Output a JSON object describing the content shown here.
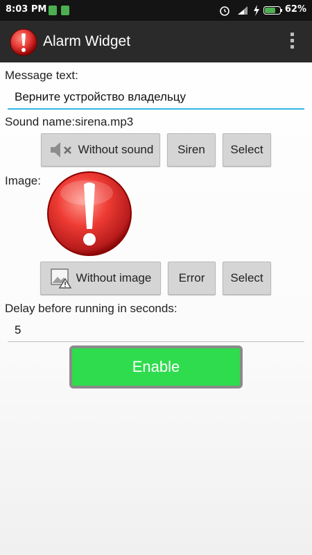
{
  "status_bar": {
    "time": "8:03 PM",
    "battery": "62%"
  },
  "app_bar": {
    "title": "Alarm Widget",
    "overflow_icon": "more-vert-icon"
  },
  "message": {
    "label": "Message text:",
    "value": "Верните устройство владельцу"
  },
  "sound": {
    "label": "Sound name:sirena.mp3",
    "without_sound_label": "Without sound",
    "siren_label": "Siren",
    "select_label": "Select"
  },
  "image": {
    "label": "Image:",
    "without_image_label": "Without image",
    "error_label": "Error",
    "select_label": "Select"
  },
  "delay": {
    "label": "Delay before running in seconds:",
    "value": "5"
  },
  "enable_button": {
    "label": "Enable",
    "color": "#2edc4e"
  },
  "colors": {
    "accent": "#33b5e5",
    "alert_red": "#e53935",
    "action_bar": "#2a2a2a"
  }
}
